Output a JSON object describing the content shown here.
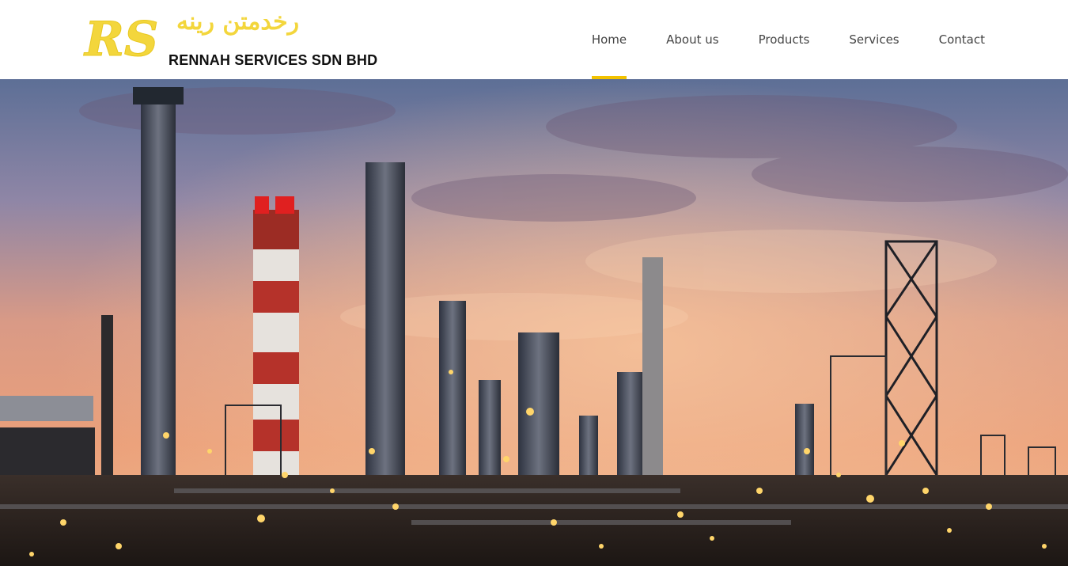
{
  "brand": {
    "logo_initials": "RS",
    "arabic_name": "ﺭﺧﺪﻣﺘﻦ ﺭﻳﻨﻪ",
    "company_name": "RENNAH SERVICES SDN BHD",
    "logo_color": "#f3d63c"
  },
  "nav": {
    "items": [
      {
        "label": "Home",
        "active": true
      },
      {
        "label": "About us",
        "active": false
      },
      {
        "label": "Products",
        "active": false
      },
      {
        "label": "Services",
        "active": false
      },
      {
        "label": "Contact",
        "active": false
      }
    ],
    "active_indicator_color": "#f2c200"
  },
  "hero": {
    "image_description": "industrial-refinery-at-sunset"
  }
}
